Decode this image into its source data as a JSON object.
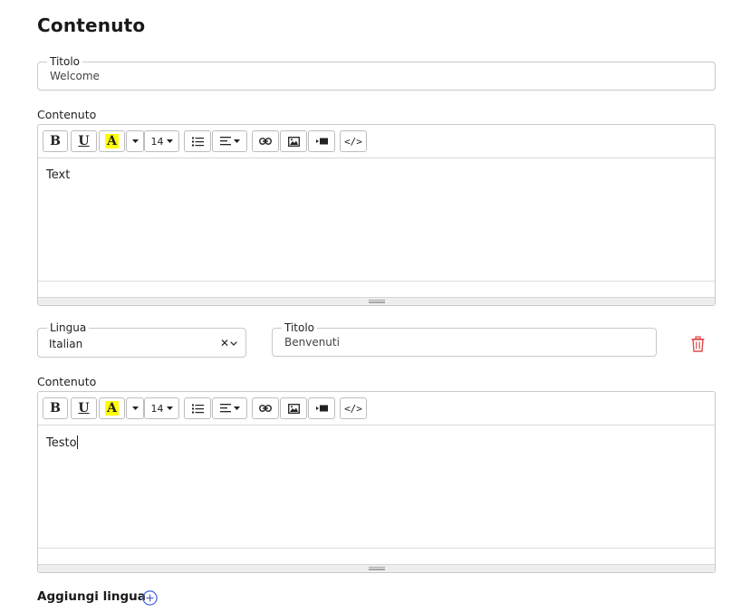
{
  "section_title": "Contenuto",
  "default_lang": {
    "title_label": "Titolo",
    "title_value": "Welcome",
    "content_label": "Contenuto",
    "content_text": "Text"
  },
  "translation": {
    "language_label": "Lingua",
    "language_value": "Italian",
    "title_label": "Titolo",
    "title_value": "Benvenuti",
    "content_label": "Contenuto",
    "content_text": "Testo"
  },
  "toolbar": {
    "bold": "B",
    "underline": "U",
    "highlight": "A",
    "font_size": "14",
    "highlight_color": "#ffff00",
    "icons": [
      "bold-icon",
      "underline-icon",
      "highlight-icon",
      "dropdown-caret-icon",
      "list-icon",
      "align-icon",
      "link-icon",
      "image-icon",
      "video-icon",
      "code-icon"
    ]
  },
  "add_language_label": "Aggiungi lingua",
  "colors": {
    "delete": "#e04b4b",
    "add": "#3b5bdb"
  }
}
